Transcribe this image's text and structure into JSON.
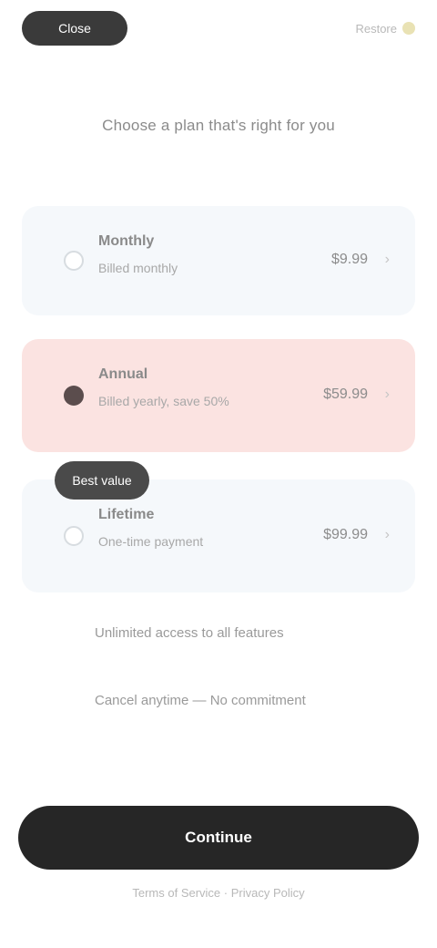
{
  "header": {
    "pill_label": "Close",
    "right_label": "Restore"
  },
  "title": "Choose a plan that's right for you",
  "plans": [
    {
      "name": "Monthly",
      "subtitle": "Billed monthly",
      "price": "$9.99",
      "selected": false
    },
    {
      "name": "Annual",
      "subtitle": "Billed yearly, save 50%",
      "price": "$59.99",
      "selected": true
    },
    {
      "name": "Lifetime",
      "subtitle": "One-time payment",
      "price": "$99.99",
      "selected": false
    }
  ],
  "badge": "Best value",
  "features": [
    "Unlimited access to all features",
    "Cancel anytime — No commitment"
  ],
  "cta": "Continue",
  "footnote": "Terms of Service · Privacy Policy",
  "colors": {
    "selected_card": "#fbe3e1",
    "card": "#f5f8fb",
    "cta": "#262626"
  },
  "icons": {
    "chevron": "chevron-right-icon",
    "selected_radio": "radio-selected-icon"
  }
}
